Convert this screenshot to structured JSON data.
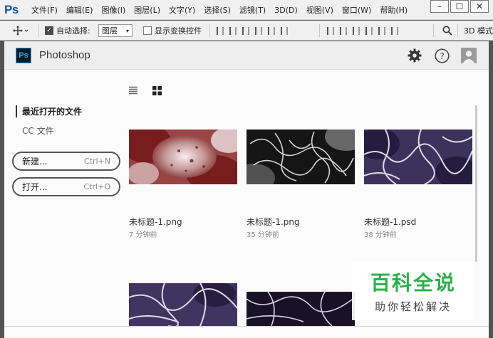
{
  "menubar": {
    "logo": "Ps",
    "items": [
      "文件(F)",
      "编辑(E)",
      "图像(I)",
      "图层(L)",
      "文字(Y)",
      "选择(S)",
      "滤镜(T)",
      "3D(D)",
      "视图(V)",
      "窗口(W)",
      "帮助(H)"
    ],
    "window_buttons": [
      "–",
      "☐",
      "✕"
    ]
  },
  "options": {
    "auto_select_label": "自动选择:",
    "auto_select_value": "图层",
    "transform_label": "显示变换控件",
    "mode_3d": "3D 模式"
  },
  "start": {
    "app_title": "Photoshop",
    "ps_icon_text": "Ps",
    "recent_heading": "最近打开的文件",
    "cc_files": "CC 文件",
    "new_label": "新建...",
    "new_shortcut": "Ctrl+N",
    "open_label": "打开...",
    "open_shortcut": "Ctrl+O",
    "files": [
      {
        "name": "未标题-1.png",
        "time": "7 分钟前"
      },
      {
        "name": "未标题-1.png",
        "time": "35 分钟前"
      },
      {
        "name": "未标题-1.psd",
        "time": "38 分钟前"
      },
      {
        "name": "",
        "time": ""
      },
      {
        "name": "",
        "time": ""
      }
    ]
  },
  "watermark": {
    "line1": "百科全说",
    "line2": "助你轻松解决"
  },
  "colors": {
    "accent_ps": "#31a8ff",
    "watermark_green": "#2db04b"
  }
}
